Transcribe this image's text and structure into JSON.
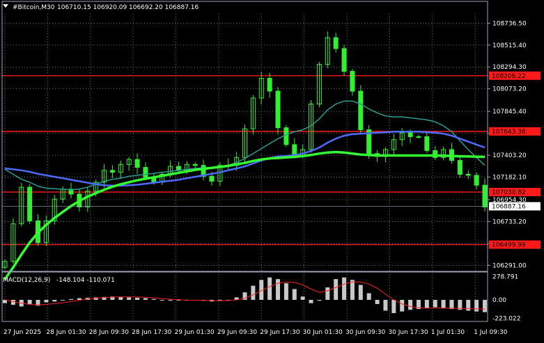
{
  "header": {
    "symbol": "#Bitcoin,M30",
    "ohlc": "106710.15 106920.09 106692.20 106887.16"
  },
  "macd": {
    "label": "MACD(12,26,9)",
    "values_text": "-148.104 -110.071",
    "axis_ticks": [
      "278.791",
      "0.00",
      "-223.022"
    ],
    "tick_values": [
      278.791,
      0,
      -223.022
    ],
    "ylim": [
      -260,
      310
    ]
  },
  "colors": {
    "background": "#000000",
    "grid": "#9aa3b8",
    "bull": "#33ee33",
    "bear": "#33ee33",
    "ma_fast": "#2a9d8f",
    "ma_mid": "#4c6cff",
    "ma_slow": "#33ff33",
    "level": "#ff1a1a",
    "histogram": "#c8c8c8",
    "signal": "#ff2020",
    "axis_text": "#ffffff",
    "level_label_bg": "#ff1a1a",
    "price_label_bg": "#ffffff"
  },
  "chart_data": {
    "type": "candlestick",
    "symbol": "#Bitcoin",
    "timeframe": "M30",
    "ylim": [
      106230,
      108830
    ],
    "y_ticks": [
      "108736.50",
      "108515.40",
      "108294.30",
      "108073.20",
      "107845.40",
      "107624.30",
      "107403.20",
      "107182.10",
      "106954.30",
      "106733.20",
      "106512.10",
      "106291.00"
    ],
    "y_tick_values": [
      108736.5,
      108515.4,
      108294.3,
      108073.2,
      107845.4,
      107624.3,
      107403.2,
      107182.1,
      106954.3,
      106733.2,
      106512.1,
      106291.0
    ],
    "x_ticks": [
      "27 Jun 2025",
      "28 Jun 01:30",
      "28 Jun 09:30",
      "28 Jun 17:30",
      "29 Jun 01:30",
      "29 Jun 09:30",
      "29 Jun 17:30",
      "30 Jun 01:30",
      "30 Jun 09:30",
      "30 Jun 17:30",
      "1 Jul 01:30",
      "1 Jul 09:30"
    ],
    "levels": [
      {
        "value": 108206.22,
        "label": "108206.22"
      },
      {
        "value": 107643.36,
        "label": "107643.36"
      },
      {
        "value": 107030.82,
        "label": "107030.82"
      },
      {
        "value": 106499.99,
        "label": "106499.99"
      }
    ],
    "last_price": {
      "value": 106887.16,
      "label": "106887.16"
    },
    "series": [
      {
        "kind": "close",
        "values": [
          106330,
          106710,
          107080,
          106740,
          106520,
          106740,
          106960,
          107060,
          107010,
          106880,
          107040,
          107130,
          107250,
          107230,
          107310,
          107360,
          107280,
          107180,
          107130,
          107210,
          107290,
          107250,
          107310,
          107300,
          107190,
          107140,
          107300,
          107300,
          107380,
          107670,
          107980,
          108180,
          108050,
          107680,
          107510,
          107400,
          107460,
          107920,
          108320,
          108590,
          108480,
          108250,
          108050,
          107660,
          107420,
          107390,
          107460,
          107560,
          107630,
          107590,
          107590,
          107450,
          107380,
          107460,
          107350,
          107210,
          107200,
          107100,
          106880
        ]
      },
      {
        "kind": "ma",
        "period": "fast",
        "values": [
          107260,
          107210,
          107160,
          107130,
          107090,
          107070,
          107065,
          107060,
          107055,
          107060,
          107080,
          107110,
          107140,
          107160,
          107170,
          107190,
          107200,
          107210,
          107220,
          107230,
          107240,
          107250,
          107260,
          107270,
          107275,
          107280,
          107285,
          107300,
          107330,
          107370,
          107420,
          107470,
          107520,
          107570,
          107610,
          107640,
          107660,
          107700,
          107770,
          107860,
          107920,
          107950,
          107950,
          107920,
          107870,
          107830,
          107800,
          107790,
          107790,
          107780,
          107770,
          107760,
          107740,
          107700,
          107640,
          107550,
          107460,
          107380,
          107300
        ]
      },
      {
        "kind": "ma",
        "period": "mid",
        "values": [
          107270,
          107260,
          107250,
          107235,
          107215,
          107200,
          107185,
          107170,
          107155,
          107140,
          107125,
          107110,
          107100,
          107095,
          107095,
          107100,
          107105,
          107115,
          107125,
          107135,
          107145,
          107155,
          107170,
          107185,
          107200,
          107215,
          107230,
          107250,
          107270,
          107290,
          107320,
          107350,
          107375,
          107390,
          107395,
          107405,
          107420,
          107445,
          107480,
          107530,
          107570,
          107600,
          107615,
          107620,
          107625,
          107630,
          107635,
          107640,
          107640,
          107640,
          107640,
          107635,
          107630,
          107620,
          107600,
          107570,
          107540,
          107510,
          107480
        ]
      },
      {
        "kind": "ma",
        "period": "slow",
        "values": [
          106150,
          106270,
          106400,
          106520,
          106620,
          106700,
          106770,
          106830,
          106890,
          106940,
          106985,
          107020,
          107055,
          107085,
          107110,
          107130,
          107150,
          107165,
          107180,
          107195,
          107210,
          107225,
          107240,
          107255,
          107265,
          107275,
          107285,
          107295,
          107310,
          107325,
          107345,
          107360,
          107370,
          107375,
          107380,
          107385,
          107395,
          107405,
          107420,
          107430,
          107435,
          107430,
          107420,
          107410,
          107405,
          107400,
          107400,
          107400,
          107400,
          107400,
          107400,
          107400,
          107400,
          107398,
          107395,
          107392,
          107390,
          107388,
          107386
        ]
      },
      {
        "kind": "macd_hist",
        "values": [
          -40,
          -60,
          -80,
          -50,
          -70,
          -30,
          -20,
          0,
          10,
          20,
          25,
          30,
          35,
          40,
          35,
          30,
          25,
          20,
          10,
          0,
          -10,
          -5,
          0,
          -5,
          -10,
          -20,
          -10,
          0,
          30,
          90,
          170,
          240,
          270,
          250,
          200,
          130,
          40,
          -40,
          -10,
          150,
          250,
          270,
          240,
          180,
          80,
          -50,
          -130,
          -160,
          -140,
          -120,
          -110,
          -100,
          -90,
          -100,
          -110,
          -120,
          -130,
          -140,
          -148
        ]
      },
      {
        "kind": "macd_signal",
        "values": [
          0,
          -20,
          -40,
          -55,
          -60,
          -55,
          -45,
          -35,
          -20,
          -5,
          10,
          20,
          28,
          33,
          36,
          36,
          34,
          30,
          24,
          16,
          8,
          2,
          -2,
          -4,
          -6,
          -9,
          -10,
          -8,
          0,
          20,
          60,
          110,
          160,
          200,
          215,
          210,
          180,
          130,
          90,
          110,
          150,
          190,
          215,
          215,
          190,
          140,
          70,
          0,
          -50,
          -80,
          -95,
          -100,
          -100,
          -100,
          -100,
          -102,
          -105,
          -108,
          -110
        ]
      }
    ]
  }
}
